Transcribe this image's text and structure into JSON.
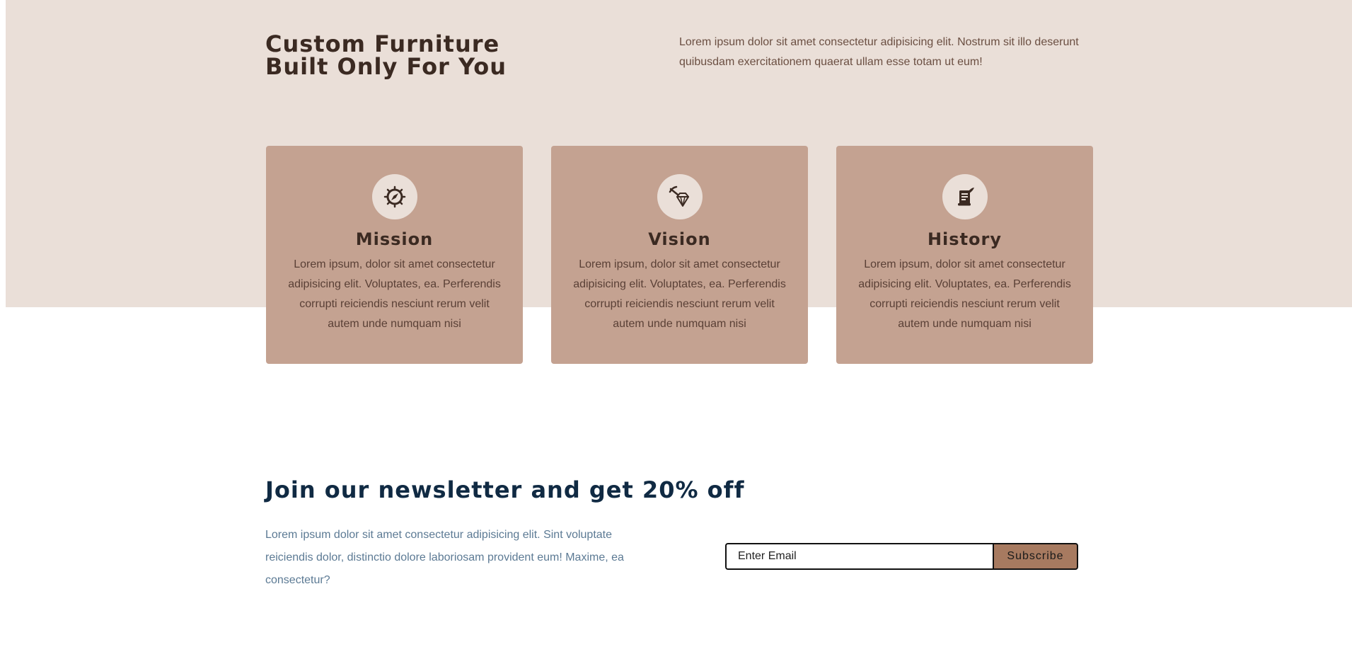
{
  "hero": {
    "title_line1": "Custom Furniture",
    "title_line2": "Built Only For You",
    "text": "Lorem ipsum dolor sit amet consectetur adipisicing elit. Nostrum sit illo deserunt quibusdam exercitationem quaerat ullam esse totam ut eum!"
  },
  "cards": [
    {
      "icon": "compass-icon",
      "title": "Mission",
      "text": "Lorem ipsum, dolor sit amet consectetur adipisicing elit. Voluptates, ea. Perferendis corrupti reiciendis nesciunt rerum velit autem unde numquam nisi"
    },
    {
      "icon": "diamond-icon",
      "title": "Vision",
      "text": "Lorem ipsum, dolor sit amet consectetur adipisicing elit. Voluptates, ea. Perferendis corrupti reiciendis nesciunt rerum velit autem unde numquam nisi"
    },
    {
      "icon": "document-scroll-icon",
      "title": "History",
      "text": "Lorem ipsum, dolor sit amet consectetur adipisicing elit. Voluptates, ea. Perferendis corrupti reiciendis nesciunt rerum velit autem unde numquam nisi"
    }
  ],
  "newsletter": {
    "title": "Join our newsletter and get 20% off",
    "text": "Lorem ipsum dolor sit amet consectetur adipisicing elit. Sint voluptate reiciendis dolor, distinctio dolore laboriosam provident eum! Maxime, ea consectetur?",
    "email_placeholder": "Enter Email",
    "email_value": "",
    "subscribe_label": "Subscribe"
  },
  "colors": {
    "hero_background": "#eadfd8",
    "card_background": "#c4a291",
    "heading_dark": "#3b2a22",
    "newsletter_heading": "#102a43",
    "subscribe_button": "#a77a60"
  }
}
